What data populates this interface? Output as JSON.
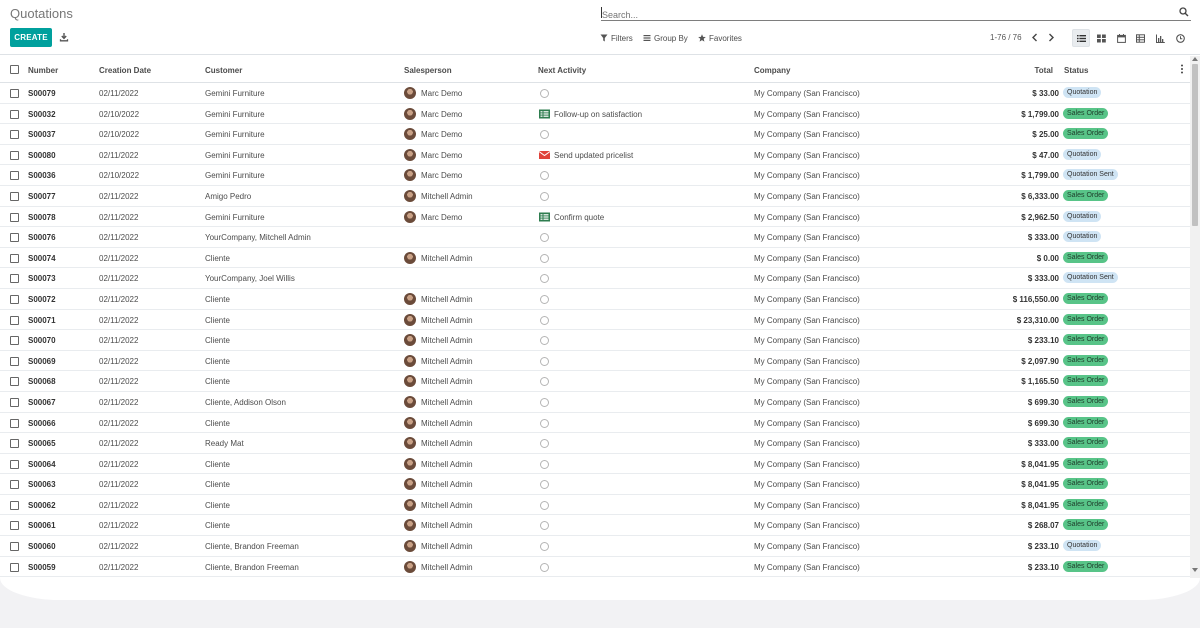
{
  "page": {
    "title": "Quotations"
  },
  "search": {
    "placeholder": "Search..."
  },
  "toolbar": {
    "create_label": "CREATE",
    "filters_label": "Filters",
    "groupby_label": "Group By",
    "favorites_label": "Favorites",
    "pager_text": "1-76 / 76"
  },
  "views": [
    "list-view",
    "kanban-view",
    "calendar-view",
    "pivot-view",
    "graph-view",
    "activity-view"
  ],
  "table": {
    "columns": {
      "number": "Number",
      "creation_date": "Creation Date",
      "customer": "Customer",
      "salesperson": "Salesperson",
      "next_activity": "Next Activity",
      "company": "Company",
      "total": "Total",
      "status": "Status"
    },
    "rows": [
      {
        "number": "S00079",
        "date": "02/11/2022",
        "customer": "Gemini Furniture",
        "salesperson": "Marc Demo",
        "activity": "",
        "activity_icon": "",
        "company": "My Company (San Francisco)",
        "total": "$ 33.00",
        "status": "Quotation",
        "status_type": "q"
      },
      {
        "number": "S00032",
        "date": "02/10/2022",
        "customer": "Gemini Furniture",
        "salesperson": "Marc Demo",
        "activity": "Follow-up on satisfaction",
        "activity_icon": "task-icon",
        "company": "My Company (San Francisco)",
        "total": "$ 1,799.00",
        "status": "Sales Order",
        "status_type": "so"
      },
      {
        "number": "S00037",
        "date": "02/10/2022",
        "customer": "Gemini Furniture",
        "salesperson": "Marc Demo",
        "activity": "",
        "activity_icon": "",
        "company": "My Company (San Francisco)",
        "total": "$ 25.00",
        "status": "Sales Order",
        "status_type": "so"
      },
      {
        "number": "S00080",
        "date": "02/11/2022",
        "customer": "Gemini Furniture",
        "salesperson": "Marc Demo",
        "activity": "Send updated pricelist",
        "activity_icon": "email-icon",
        "company": "My Company (San Francisco)",
        "total": "$ 47.00",
        "status": "Quotation",
        "status_type": "q"
      },
      {
        "number": "S00036",
        "date": "02/10/2022",
        "customer": "Gemini Furniture",
        "salesperson": "Marc Demo",
        "activity": "",
        "activity_icon": "",
        "company": "My Company (San Francisco)",
        "total": "$ 1,799.00",
        "status": "Quotation Sent",
        "status_type": "qs"
      },
      {
        "number": "S00077",
        "date": "02/11/2022",
        "customer": "Amigo Pedro",
        "salesperson": "Mitchell Admin",
        "activity": "",
        "activity_icon": "",
        "company": "My Company (San Francisco)",
        "total": "$ 6,333.00",
        "status": "Sales Order",
        "status_type": "so"
      },
      {
        "number": "S00078",
        "date": "02/11/2022",
        "customer": "Gemini Furniture",
        "salesperson": "Marc Demo",
        "activity": "Confirm quote",
        "activity_icon": "task-icon",
        "company": "My Company (San Francisco)",
        "total": "$ 2,962.50",
        "status": "Quotation",
        "status_type": "q"
      },
      {
        "number": "S00076",
        "date": "02/11/2022",
        "customer": "YourCompany, Mitchell Admin",
        "salesperson": "",
        "activity": "",
        "activity_icon": "",
        "company": "My Company (San Francisco)",
        "total": "$ 333.00",
        "status": "Quotation",
        "status_type": "q"
      },
      {
        "number": "S00074",
        "date": "02/11/2022",
        "customer": "Cliente",
        "salesperson": "Mitchell Admin",
        "activity": "",
        "activity_icon": "",
        "company": "My Company (San Francisco)",
        "total": "$ 0.00",
        "status": "Sales Order",
        "status_type": "so"
      },
      {
        "number": "S00073",
        "date": "02/11/2022",
        "customer": "YourCompany, Joel Willis",
        "salesperson": "",
        "activity": "",
        "activity_icon": "",
        "company": "My Company (San Francisco)",
        "total": "$ 333.00",
        "status": "Quotation Sent",
        "status_type": "qs"
      },
      {
        "number": "S00072",
        "date": "02/11/2022",
        "customer": "Cliente",
        "salesperson": "Mitchell Admin",
        "activity": "",
        "activity_icon": "",
        "company": "My Company (San Francisco)",
        "total": "$ 116,550.00",
        "status": "Sales Order",
        "status_type": "so"
      },
      {
        "number": "S00071",
        "date": "02/11/2022",
        "customer": "Cliente",
        "salesperson": "Mitchell Admin",
        "activity": "",
        "activity_icon": "",
        "company": "My Company (San Francisco)",
        "total": "$ 23,310.00",
        "status": "Sales Order",
        "status_type": "so"
      },
      {
        "number": "S00070",
        "date": "02/11/2022",
        "customer": "Cliente",
        "salesperson": "Mitchell Admin",
        "activity": "",
        "activity_icon": "",
        "company": "My Company (San Francisco)",
        "total": "$ 233.10",
        "status": "Sales Order",
        "status_type": "so"
      },
      {
        "number": "S00069",
        "date": "02/11/2022",
        "customer": "Cliente",
        "salesperson": "Mitchell Admin",
        "activity": "",
        "activity_icon": "",
        "company": "My Company (San Francisco)",
        "total": "$ 2,097.90",
        "status": "Sales Order",
        "status_type": "so"
      },
      {
        "number": "S00068",
        "date": "02/11/2022",
        "customer": "Cliente",
        "salesperson": "Mitchell Admin",
        "activity": "",
        "activity_icon": "",
        "company": "My Company (San Francisco)",
        "total": "$ 1,165.50",
        "status": "Sales Order",
        "status_type": "so"
      },
      {
        "number": "S00067",
        "date": "02/11/2022",
        "customer": "Cliente, Addison Olson",
        "salesperson": "Mitchell Admin",
        "activity": "",
        "activity_icon": "",
        "company": "My Company (San Francisco)",
        "total": "$ 699.30",
        "status": "Sales Order",
        "status_type": "so"
      },
      {
        "number": "S00066",
        "date": "02/11/2022",
        "customer": "Cliente",
        "salesperson": "Mitchell Admin",
        "activity": "",
        "activity_icon": "",
        "company": "My Company (San Francisco)",
        "total": "$ 699.30",
        "status": "Sales Order",
        "status_type": "so"
      },
      {
        "number": "S00065",
        "date": "02/11/2022",
        "customer": "Ready Mat",
        "salesperson": "Mitchell Admin",
        "activity": "",
        "activity_icon": "",
        "company": "My Company (San Francisco)",
        "total": "$ 333.00",
        "status": "Sales Order",
        "status_type": "so"
      },
      {
        "number": "S00064",
        "date": "02/11/2022",
        "customer": "Cliente",
        "salesperson": "Mitchell Admin",
        "activity": "",
        "activity_icon": "",
        "company": "My Company (San Francisco)",
        "total": "$ 8,041.95",
        "status": "Sales Order",
        "status_type": "so"
      },
      {
        "number": "S00063",
        "date": "02/11/2022",
        "customer": "Cliente",
        "salesperson": "Mitchell Admin",
        "activity": "",
        "activity_icon": "",
        "company": "My Company (San Francisco)",
        "total": "$ 8,041.95",
        "status": "Sales Order",
        "status_type": "so"
      },
      {
        "number": "S00062",
        "date": "02/11/2022",
        "customer": "Cliente",
        "salesperson": "Mitchell Admin",
        "activity": "",
        "activity_icon": "",
        "company": "My Company (San Francisco)",
        "total": "$ 8,041.95",
        "status": "Sales Order",
        "status_type": "so"
      },
      {
        "number": "S00061",
        "date": "02/11/2022",
        "customer": "Cliente",
        "salesperson": "Mitchell Admin",
        "activity": "",
        "activity_icon": "",
        "company": "My Company (San Francisco)",
        "total": "$ 268.07",
        "status": "Sales Order",
        "status_type": "so"
      },
      {
        "number": "S00060",
        "date": "02/11/2022",
        "customer": "Cliente, Brandon Freeman",
        "salesperson": "Mitchell Admin",
        "activity": "",
        "activity_icon": "",
        "company": "My Company (San Francisco)",
        "total": "$ 233.10",
        "status": "Quotation",
        "status_type": "q"
      },
      {
        "number": "S00059",
        "date": "02/11/2022",
        "customer": "Cliente, Brandon Freeman",
        "salesperson": "Mitchell Admin",
        "activity": "",
        "activity_icon": "",
        "company": "My Company (San Francisco)",
        "total": "$ 233.10",
        "status": "Sales Order",
        "status_type": "so"
      }
    ]
  },
  "colors": {
    "primary": "#00a09d",
    "sales_order_badge": "#58c488",
    "quotation_badge": "#cfe4f4"
  }
}
